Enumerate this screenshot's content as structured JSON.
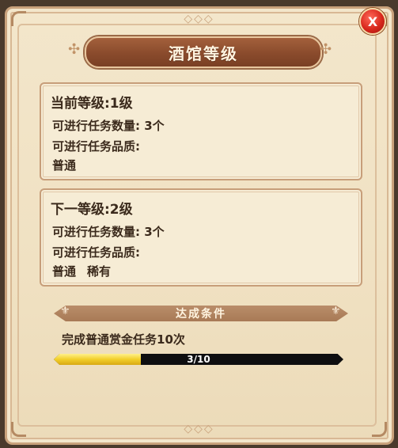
{
  "title": "酒馆等级",
  "close_label": "X",
  "current": {
    "heading": "当前等级:1级",
    "task_count": "可进行任务数量: 3个",
    "quality_label": "可进行任务品质:",
    "qualities": [
      "普通"
    ]
  },
  "next": {
    "heading": "下一等级:2级",
    "task_count": "可进行任务数量: 3个",
    "quality_label": "可进行任务品质:",
    "qualities": [
      "普通",
      "稀有"
    ]
  },
  "condition": {
    "title": "达成条件",
    "requirement": "完成普通赏金任务10次",
    "progress_text": "3/10",
    "progress_fraction": 0.3
  },
  "colors": {
    "accent": "#8a4b2c",
    "close": "#d8271c",
    "progress": "#f2cf2a"
  }
}
